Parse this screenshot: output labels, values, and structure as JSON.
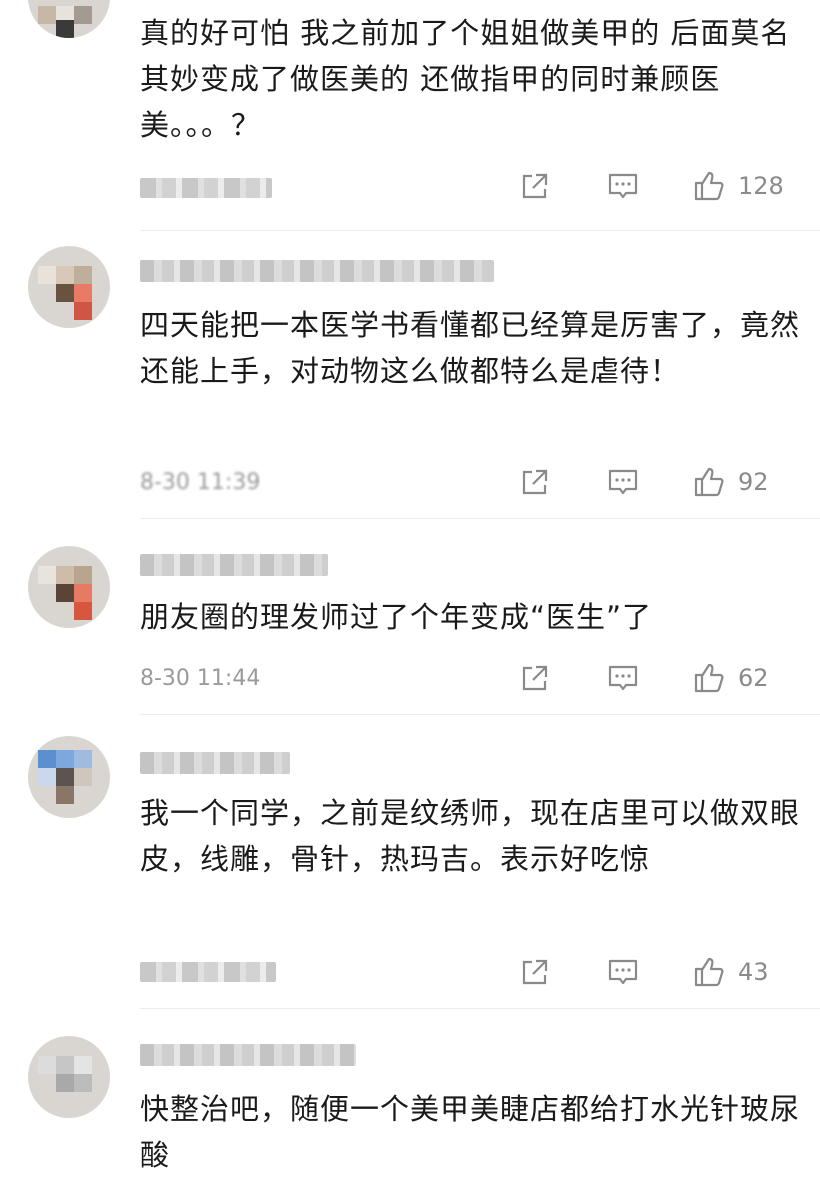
{
  "comments": [
    {
      "id": "c1",
      "text": "真的好可怕 我之前加了个姐姐做美甲的 后面莫名其妙变成了做医美的 还做指甲的同时兼顾医美。。。？",
      "time": "",
      "likes": "128",
      "share_icon": "share-icon",
      "reply_icon": "comment-icon",
      "like_icon": "thumbs-up-icon"
    },
    {
      "id": "c2",
      "text": "四天能把一本医学书看懂都已经算是厉害了，竟然还能上手，对动物这么做都特么是虐待！",
      "time": "8-30 11:39",
      "likes": "92",
      "share_icon": "share-icon",
      "reply_icon": "comment-icon",
      "like_icon": "thumbs-up-icon"
    },
    {
      "id": "c3",
      "text": "朋友圈的理发师过了个年变成“医生”了",
      "time": "8-30 11:44",
      "likes": "62",
      "share_icon": "share-icon",
      "reply_icon": "comment-icon",
      "like_icon": "thumbs-up-icon"
    },
    {
      "id": "c4",
      "text": "我一个同学，之前是纹绣师，现在店里可以做双眼皮，线雕，骨针，热玛吉。表示好吃惊",
      "time": "",
      "likes": "43",
      "share_icon": "share-icon",
      "reply_icon": "comment-icon",
      "like_icon": "thumbs-up-icon"
    },
    {
      "id": "c5",
      "text": "快整治吧，随便一个美甲美睫店都给打水光针玻尿酸",
      "time": "",
      "likes": ""
    }
  ],
  "colors": {
    "text": "#1a1a1a",
    "meta": "#9a9a9a",
    "icon": "#8a8a8a",
    "divider": "#ececec"
  }
}
